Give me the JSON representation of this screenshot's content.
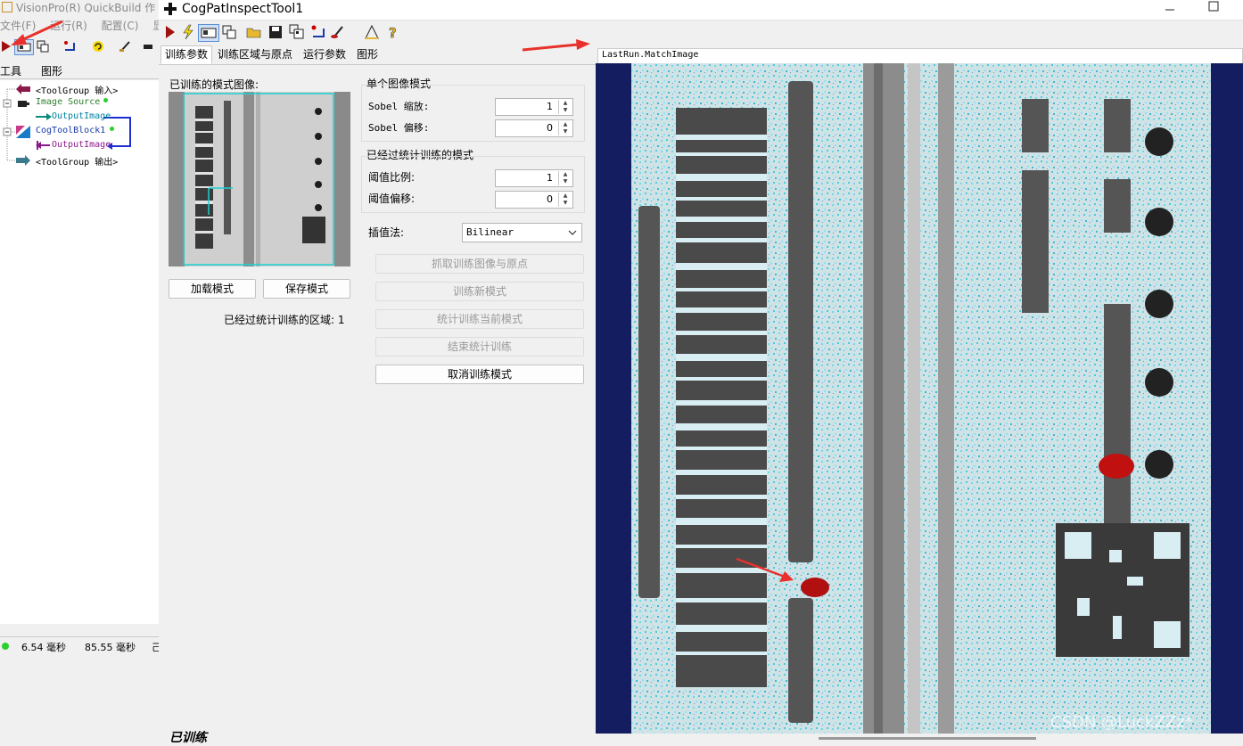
{
  "background_window": {
    "title": "VisionPro(R) QuickBuild 作",
    "menu": [
      "文件(F)",
      "运行(R)",
      "配置(C)",
      "显示"
    ],
    "tabs": [
      "工具",
      "图形"
    ],
    "tree": [
      {
        "label": "<ToolGroup 输入>",
        "color": "#000000"
      },
      {
        "label": "Image Source",
        "color": "#2f7f2f"
      },
      {
        "label": "OutputImage",
        "color": "#0080a0"
      },
      {
        "label": "CogToolBlock1",
        "color": "#1a3aa8"
      },
      {
        "label": "OutputImage",
        "color": "#8a1a8a"
      },
      {
        "label": "<ToolGroup 输出>",
        "color": "#000000"
      }
    ],
    "status": {
      "time1": "6.54 毫秒",
      "time2": "85.55 毫秒",
      "extra": "己"
    }
  },
  "tool_window": {
    "title": "CogPatInspectTool1",
    "tabs": [
      "训练参数",
      "训练区域与原点",
      "运行参数",
      "图形"
    ],
    "trained_image_label": "已训练的模式图像:",
    "load_pattern": "加载模式",
    "save_pattern": "保存模式",
    "trained_region_count": "已经过统计训练的区域: 1",
    "single_image_group": {
      "title": "单个图像模式",
      "sobel_scale_label": "Sobel 缩放:",
      "sobel_scale": "1",
      "sobel_offset_label": "Sobel 偏移:",
      "sobel_offset": "0"
    },
    "stat_group": {
      "title": "已经过统计训练的模式",
      "threshold_scale_label": "阈值比例:",
      "threshold_scale": "1",
      "threshold_offset_label": "阈值偏移:",
      "threshold_offset": "0"
    },
    "interp_label": "插值法:",
    "interp_value": "Bilinear",
    "buttons": {
      "grab": "抓取训练图像与原点",
      "train_new": "训练新模式",
      "stat_train": "统计训练当前模式",
      "end_stat": "结束统计训练",
      "cancel": "取消训练模式"
    },
    "status_text": "已训练",
    "image_caption": "LastRun.MatchImage",
    "watermark": "CSDN @LuckZZz*"
  },
  "colors": {
    "accent_red": "#e8312b",
    "navy": "#131d60"
  }
}
